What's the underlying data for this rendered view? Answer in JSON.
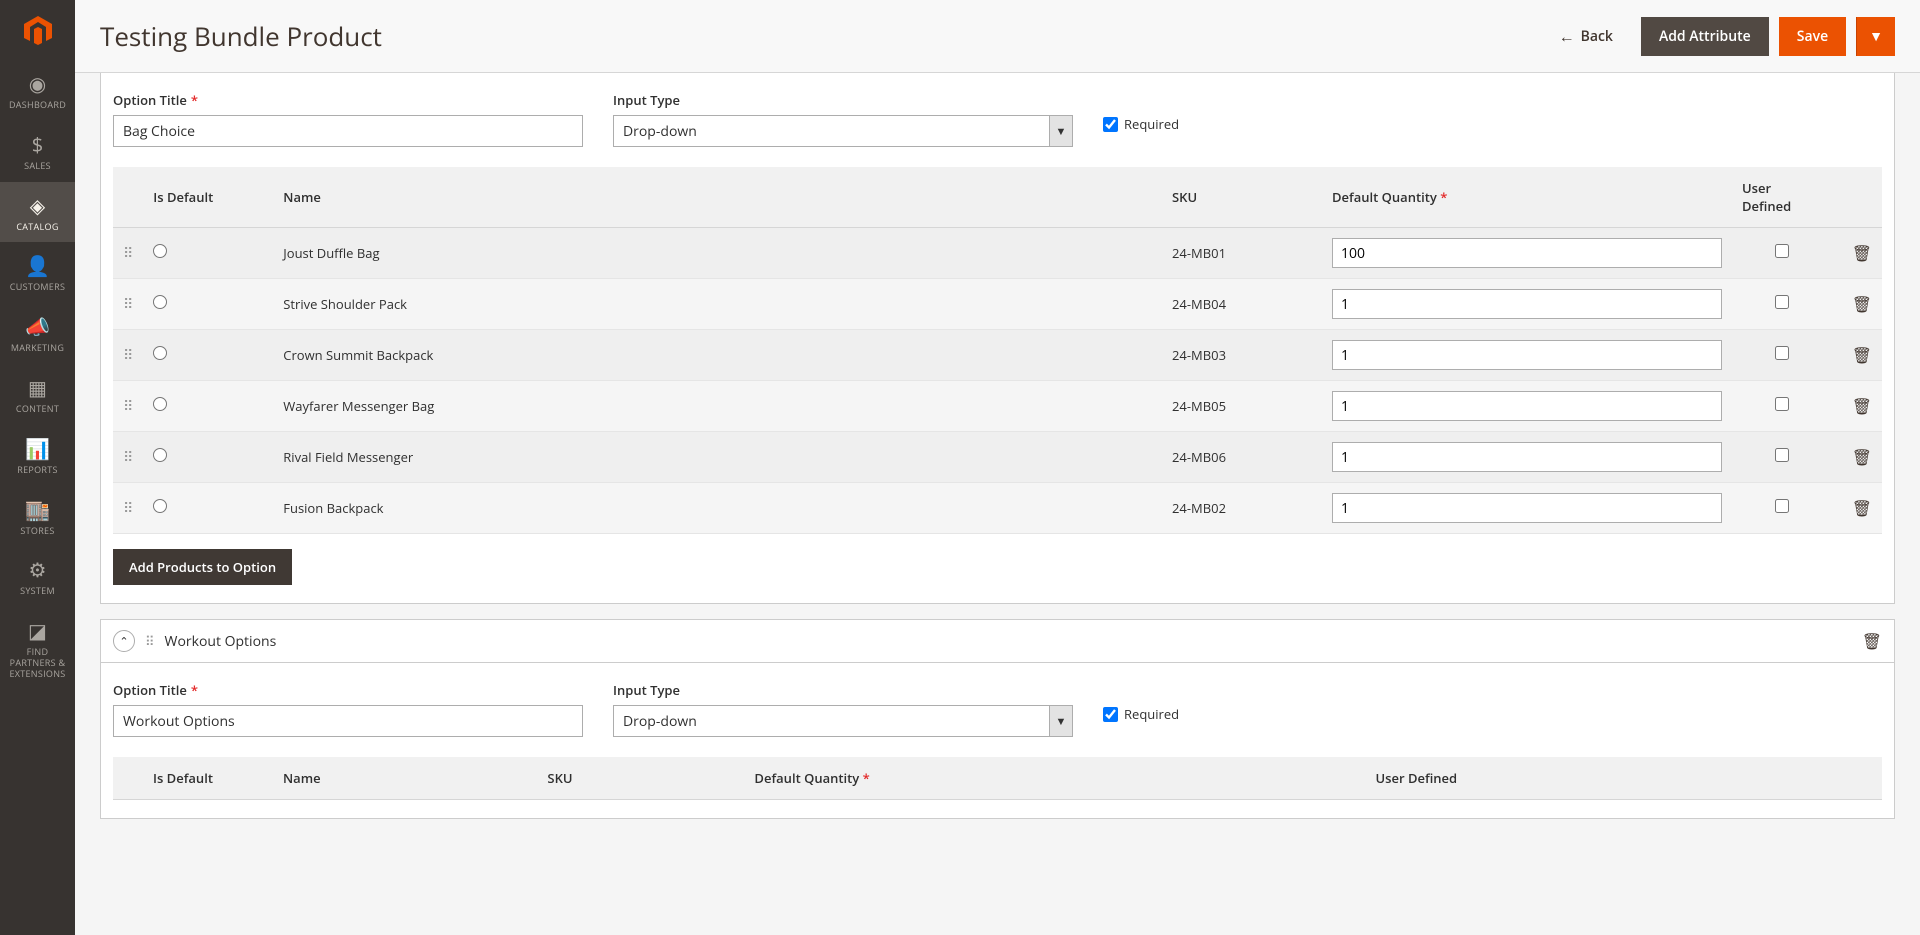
{
  "page_title": "Testing Bundle Product",
  "header": {
    "back": "Back",
    "add_attribute": "Add Attribute",
    "save": "Save"
  },
  "sidebar": {
    "items": [
      {
        "label": "Dashboard",
        "icon": "◉"
      },
      {
        "label": "Sales",
        "icon": "$"
      },
      {
        "label": "Catalog",
        "icon": "◈",
        "active": true
      },
      {
        "label": "Customers",
        "icon": "👤"
      },
      {
        "label": "Marketing",
        "icon": "📣"
      },
      {
        "label": "Content",
        "icon": "▦"
      },
      {
        "label": "Reports",
        "icon": "📊"
      },
      {
        "label": "Stores",
        "icon": "🏬"
      },
      {
        "label": "System",
        "icon": "⚙"
      },
      {
        "label": "Find Partners & Extensions",
        "icon": "◪"
      }
    ]
  },
  "labels": {
    "option_title": "Option Title",
    "input_type": "Input Type",
    "required": "Required",
    "add_products": "Add Products to Option"
  },
  "table_headers": {
    "is_default": "Is Default",
    "name": "Name",
    "sku": "SKU",
    "default_qty": "Default Quantity",
    "user_defined": "User Defined"
  },
  "options": [
    {
      "title": "Bag Choice",
      "input_type": "Drop-down",
      "required": true,
      "rows": [
        {
          "name": "Joust Duffle Bag",
          "sku": "24-MB01",
          "qty": "100"
        },
        {
          "name": "Strive Shoulder Pack",
          "sku": "24-MB04",
          "qty": "1"
        },
        {
          "name": "Crown Summit Backpack",
          "sku": "24-MB03",
          "qty": "1"
        },
        {
          "name": "Wayfarer Messenger Bag",
          "sku": "24-MB05",
          "qty": "1"
        },
        {
          "name": "Rival Field Messenger",
          "sku": "24-MB06",
          "qty": "1"
        },
        {
          "name": "Fusion Backpack",
          "sku": "24-MB02",
          "qty": "1"
        }
      ]
    },
    {
      "title": "Workout Options",
      "panel_title": "Workout Options",
      "input_type": "Drop-down",
      "required": true,
      "rows": []
    }
  ]
}
